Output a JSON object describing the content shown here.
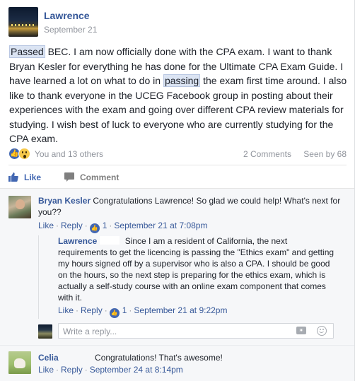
{
  "post": {
    "author": "Lawrence",
    "date": "September 21",
    "body_before": "",
    "highlight_1": "Passed",
    "body_mid": " BEC. I am now officially done with the CPA exam. I want to thank Bryan Kesler for everything he has done for the Ultimate CPA Exam Guide. I have learned a lot on what to do in ",
    "highlight_2": "passing",
    "body_after": " the exam first time around. I also like to thank everyone in the UCEG Facebook group in posting about their experiences with the exam and going over different CPA review materials for studying. I wish best of luck to everyone who are currently studying for the CPA exam."
  },
  "stats": {
    "reactions_text": "You and 13 others",
    "comments_count": "2 Comments",
    "seen_by": "Seen by 68"
  },
  "actions": {
    "like_label": "Like",
    "comment_label": "Comment"
  },
  "comments": [
    {
      "author": "Bryan Kesler",
      "text": "Congratulations Lawrence! So glad we could help! What's next for you??",
      "like": "Like",
      "reply": "Reply",
      "like_count": "1",
      "timestamp": "September 21 at 7:08pm"
    },
    {
      "author": "Celia",
      "text": "Congratulations! That's awesome!",
      "like": "Like",
      "reply": "Reply",
      "timestamp": "September 24 at 8:14pm"
    }
  ],
  "reply": {
    "author": "Lawrence",
    "text": "Since I am a resident of California, the next requirements to get the licencing is passing the \"Ethics exam\" and getting my hours signed off by a supervisor who is also a CPA. I should be good on the hours, so the next step is preparing for the ethics exam, which is actually a self-study course with an online exam component that comes with it.",
    "like": "Like",
    "reply": "Reply",
    "like_count": "1",
    "timestamp": "September 21 at 9:22pm"
  },
  "reply_input": {
    "placeholder": "Write a reply..."
  },
  "colors": {
    "link": "#365899",
    "like_blue": "#4267b2",
    "highlight_bg": "#dbe4f3",
    "comments_bg": "#f6f7f9"
  }
}
